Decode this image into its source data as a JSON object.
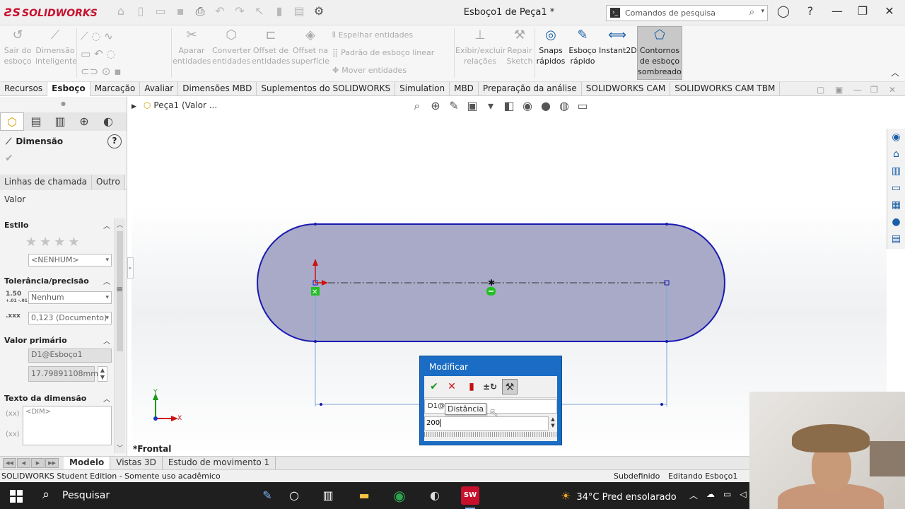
{
  "app": {
    "brand": "SOLIDWORKS",
    "doc_title": "Esboço1 de Peça1 *",
    "search_placeholder": "Comandos de pesquisa"
  },
  "ribbon": {
    "sair_esboco": "Sair do\nesboço",
    "dimensao_inteligente": "Dimensão\ninteligente",
    "aparar": "Aparar\nentidades",
    "converter": "Converter\nentidades",
    "offset_entidades": "Offset de\nentidades",
    "offset_superficie": "Offset na\nsuperfície",
    "espelhar": "Espelhar entidades",
    "padrao_linear": "Padrão de esboço linear",
    "mover": "Mover entidades",
    "exibir_relacoes": "Exibir/excluir\nrelações",
    "repair": "Repair\nSketch",
    "snaps": "Snaps\nrápidos",
    "esboco_rapido": "Esboço\nrápido",
    "instant2d": "Instant2D",
    "contornos": "Contornos\nde esboço\nsombreado"
  },
  "tabs": [
    "Recursos",
    "Esboço",
    "Marcação",
    "Avaliar",
    "Dimensões MBD",
    "Suplementos do SOLIDWORKS",
    "Simulation",
    "MBD",
    "Preparação da análise",
    "SOLIDWORKS CAM",
    "SOLIDWORKS CAM TBM"
  ],
  "active_tab": "Esboço",
  "property_manager": {
    "title": "Dimensão",
    "tab_leaders": "Linhas de chamada",
    "tab_other": "Outro",
    "valor": "Valor",
    "estilo": "Estilo",
    "estilo_value": "<NENHUM>",
    "tolerancia": "Tolerância/precisão",
    "tolerancia_value": "Nenhum",
    "precisao_value": "0,123 (Documento)",
    "valor_primario": "Valor primário",
    "primary_name": "D1@Esboço1",
    "primary_value": "17.79891108mm",
    "texto_dimensao": "Texto da dimensão",
    "dim_text": "<DIM>",
    "tol_icon_top": "1.50",
    "tol_icon_sub": "+.01 -.01",
    "prec_icon": ".xxx",
    "xx_label": "(xx)"
  },
  "tree": {
    "part": "Peça1 (Valor ..."
  },
  "view_label": "*Frontal",
  "axis": {
    "x": "X",
    "y": "Y"
  },
  "modify": {
    "title": "Modificar",
    "name": "D1@",
    "tooltip": "Distância",
    "value": "200"
  },
  "bottom_tabs": [
    "Modelo",
    "Vistas 3D",
    "Estudo de movimento 1"
  ],
  "status": {
    "left": "SOLIDWORKS Student Edition - Somente uso acadêmico",
    "state": "Subdefinido",
    "editing": "Editando Esboço1"
  },
  "taskbar": {
    "search": "Pesquisar",
    "weather": "34°C  Pred ensolarado",
    "sw_badge": "SW"
  },
  "colors": {
    "brand_red": "#c8102e",
    "sketch_blue": "#1a1ab0",
    "fill_slot": "#a8aac8",
    "dialog_blue": "#1a6cc4"
  }
}
